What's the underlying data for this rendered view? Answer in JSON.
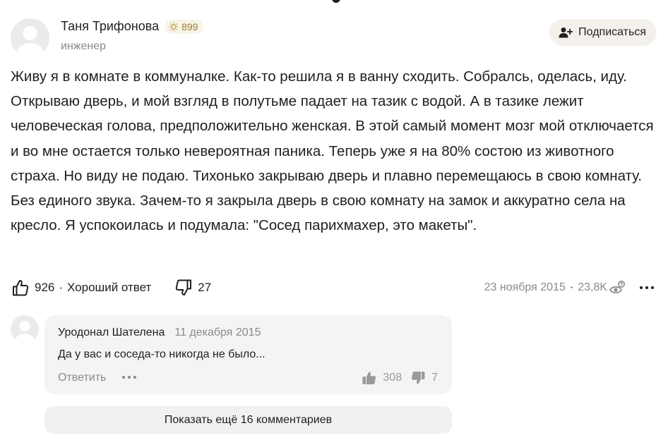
{
  "author": {
    "name": "Таня Трифонова",
    "rating": "899",
    "role": "инженер",
    "subscribe_label": "Подписаться"
  },
  "answer": {
    "text": "Живу я в комнате в коммуналке. Как-то решила я в ванну сходить. Собралсь, оделась, иду. Открываю дверь, и мой взгляд в полутьме падает на тазик с водой. А в тазике лежит человеческая голова, предположительно женская. В этой самый момент мозг мой отключается и во мне остается только невероятная паника. Теперь уже я на 80% состою из животного страха. Но виду не подаю. Тихонько закрываю дверь и плавно перемещаюсь в свою комнату. Без единого звука. Зачем-то я закрыла дверь в свою комнату на замок и аккуратно села на кресло. Я успокоилась и подумала: \"Сосед парихмахер, это макеты\"."
  },
  "actions": {
    "likes": "926",
    "separator": "·",
    "good_answer_label": "Хороший ответ",
    "dislikes": "27"
  },
  "meta": {
    "date": "23 ноября 2015",
    "separator": "·",
    "views": "23,8K"
  },
  "comment": {
    "author": "Уродонал Шателена",
    "date": "11 декабря 2015",
    "text": "Да у вас и соседа-то никогда не было...",
    "reply_label": "Ответить",
    "likes": "308",
    "dislikes": "7"
  },
  "show_more_label": "Показать ещё 16 комментариев",
  "icons": {
    "rating": "sun-badge-icon",
    "subscribe": "add-user-icon",
    "like": "thumbs-up-icon",
    "dislike": "thumbs-down-icon",
    "views": "eye-icon",
    "more": "more-horizontal-icon"
  },
  "colors": {
    "text": "#1f1f1f",
    "muted": "#8a8a8a",
    "badge_bg": "#f7f3e8",
    "badge_text": "#9a7b35",
    "button_bg": "#f4f1ec",
    "card_bg": "#f4f4f4"
  }
}
